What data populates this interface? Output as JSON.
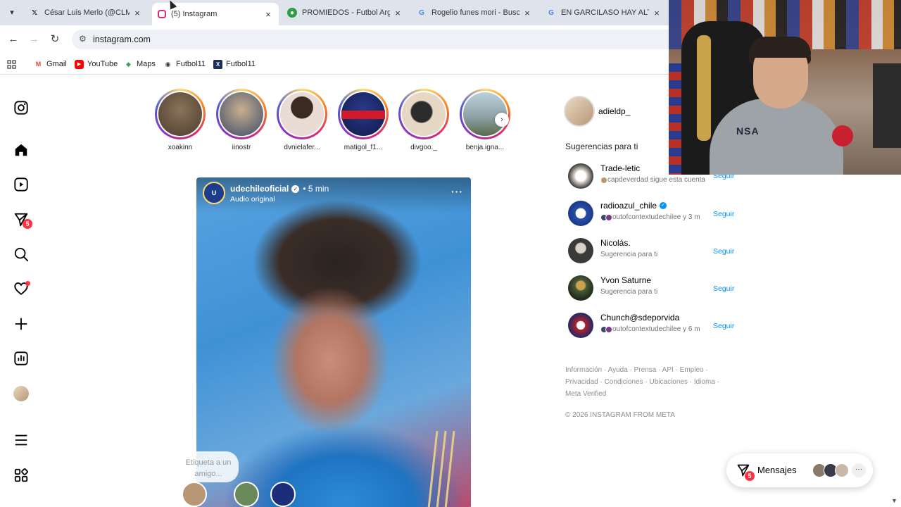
{
  "browser": {
    "tabs": [
      {
        "title": "César Luis Merlo (@CLMerlo",
        "favicon": "x-icon",
        "active": false
      },
      {
        "title": "(5) Instagram",
        "favicon": "instagram-icon",
        "active": true
      },
      {
        "title": "PROMIEDOS - Futbol Argen",
        "favicon": "soccer-ball-icon",
        "active": false
      },
      {
        "title": "Rogelio funes mori - Buscar",
        "favicon": "google-icon",
        "active": false
      },
      {
        "title": "EN GARCILASO HAY ALTURA",
        "favicon": "google-icon",
        "active": false
      }
    ],
    "url": "instagram.com",
    "bookmarks": [
      {
        "label": "Gmail",
        "icon": "gmail-icon"
      },
      {
        "label": "YouTube",
        "icon": "youtube-icon"
      },
      {
        "label": "Maps",
        "icon": "maps-icon"
      },
      {
        "label": "Futbol11",
        "icon": "globe-icon"
      },
      {
        "label": "Futbol11",
        "icon": "x-icon"
      }
    ]
  },
  "nav": {
    "reels_badge": "5",
    "icons": [
      "instagram-logo-icon",
      "home-icon",
      "reels-icon",
      "messages-icon",
      "search-icon",
      "heart-icon",
      "plus-icon",
      "insights-icon",
      "profile-icon",
      "menu-icon",
      "apps-icon"
    ]
  },
  "stories": [
    {
      "name": "xoakinn",
      "color": "#6b5a48"
    },
    {
      "name": "iinostr",
      "color": "#3a4a6a"
    },
    {
      "name": "dvnielafer...",
      "color": "#d9c7bf"
    },
    {
      "name": "matigol_f1...",
      "color": "#1c2a6a"
    },
    {
      "name": "divgoo._",
      "color": "#b9a893"
    },
    {
      "name": "benja.igna...",
      "color": "#8fa3a8"
    }
  ],
  "post": {
    "username": "udechileoficial",
    "time": "• 5 min",
    "audio": "Audio original",
    "tag_prompt": "Etiqueta a un amigo...",
    "avatar_text": "U"
  },
  "sidebar": {
    "me": "adieldp_",
    "suggestions_title": "Sugerencias para ti",
    "follow_label": "Seguir",
    "suggestions": [
      {
        "username": "Trade-letic",
        "subtitle": "capdeverdad sigue esta cuenta",
        "verified": false,
        "color": "#e9e2d6"
      },
      {
        "username": "radioazul_chile",
        "subtitle": "outofcontextudechilee y 3 m",
        "verified": true,
        "color": "#2a4ea8"
      },
      {
        "username": "Nicolás.",
        "subtitle": "Sugerencia para ti",
        "verified": false,
        "color": "#3a3a3a"
      },
      {
        "username": "Yvon Saturne",
        "subtitle": "Sugerencia para ti",
        "verified": false,
        "color": "#4a5a3a"
      },
      {
        "username": "Chunch@sdeporvida",
        "subtitle": "outofcontextudechilee y 6 m",
        "verified": false,
        "color": "#b2202a"
      }
    ],
    "footer_line1": "Información · Ayuda · Prensa · API · Empleo ·",
    "footer_line2": "Privacidad · Condiciones · Ubicaciones · Idioma ·",
    "footer_line3": "Meta Verified",
    "copyright": "© 2026 INSTAGRAM FROM META"
  },
  "messages": {
    "label": "Mensajes",
    "badge": "5",
    "more": "···"
  },
  "webcam": {
    "shirt_text": "NSA"
  },
  "colors": {
    "link_blue": "#0095f6",
    "badge_red": "#ff3040"
  }
}
